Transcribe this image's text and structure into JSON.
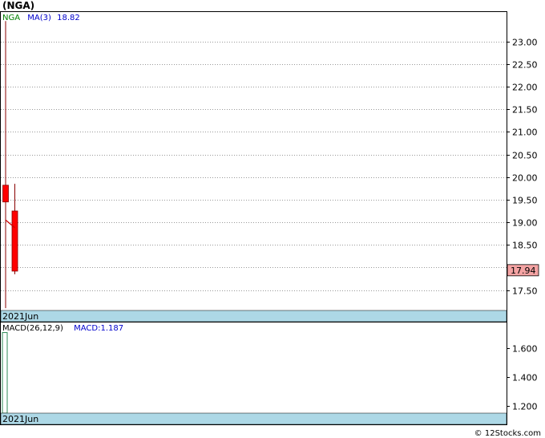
{
  "title": "(NGA)",
  "footer": "© 12Stocks.com",
  "chart_data": [
    {
      "type": "candlestick",
      "legend": {
        "symbol": "NGA",
        "ma_label": "MA(3)",
        "ma_value": "18.82"
      },
      "ylim": [
        17.05,
        23.65
      ],
      "yticks": [
        "23.00",
        "22.50",
        "22.00",
        "21.50",
        "21.00",
        "20.50",
        "20.00",
        "19.50",
        "19.00",
        "18.50",
        "18.00",
        "17.50"
      ],
      "last_price": "17.94",
      "date_label": "2021Jun",
      "candles": [
        {
          "open": 19.45,
          "close": 19.82,
          "high": 23.45,
          "low": 17.1,
          "color": "#ff0000"
        },
        {
          "open": 19.25,
          "close": 17.92,
          "high": 19.85,
          "low": 17.85,
          "color": "#ff0000"
        }
      ],
      "ma_line": [
        19.05,
        18.88
      ],
      "colors": {
        "up": "#ff0000",
        "down": "#ff0000",
        "ma": "#cc0000",
        "price_box": "#f4a3a3",
        "date_band": "#add8e6"
      }
    },
    {
      "type": "bar",
      "legend": {
        "indicator": "MACD(26,12,9)",
        "macd_label": "MACD:",
        "macd_value": "1.187"
      },
      "ylim": [
        1.15,
        1.78
      ],
      "yticks": [
        "1.600",
        "1.400",
        "1.200"
      ],
      "date_label": "2021Jun",
      "values": [
        1.71
      ],
      "colors": {
        "bar": "#2e8b57",
        "date_band": "#add8e6"
      }
    }
  ]
}
